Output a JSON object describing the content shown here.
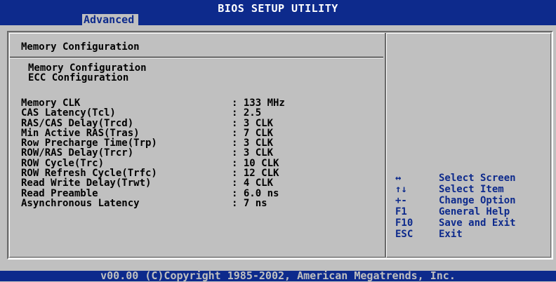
{
  "header": {
    "title": "BIOS SETUP UTILITY",
    "active_tab": "Advanced"
  },
  "panel": {
    "title": "Memory Configuration",
    "submenus": [
      "Memory Configuration",
      "ECC Configuration"
    ],
    "settings": [
      {
        "label": "Memory CLK",
        "value": ": 133 MHz"
      },
      {
        "label": "CAS Latency(Tcl)",
        "value": ": 2.5"
      },
      {
        "label": "RAS/CAS Delay(Trcd)",
        "value": ": 3 CLK"
      },
      {
        "label": "Min Active RAS(Tras)",
        "value": ": 7 CLK"
      },
      {
        "label": "Row Precharge Time(Trp)",
        "value": ": 3 CLK"
      },
      {
        "label": "ROW/RAS Delay(Trcr)",
        "value": ": 3 CLK"
      },
      {
        "label": "ROW Cycle(Trc)",
        "value": ": 10 CLK"
      },
      {
        "label": "ROW Refresh Cycle(Trfc)",
        "value": ": 12 CLK"
      },
      {
        "label": "Read Write Delay(Trwt)",
        "value": ": 4 CLK"
      },
      {
        "label": "Read Preamble",
        "value": ": 6.0 ns"
      },
      {
        "label": "Asynchronous Latency",
        "value": ": 7 ns"
      }
    ]
  },
  "help": [
    {
      "key": "↔",
      "action": "Select Screen"
    },
    {
      "key": "↑↓",
      "action": "Select Item"
    },
    {
      "key": "+-",
      "action": "Change Option"
    },
    {
      "key": "F1",
      "action": "General Help"
    },
    {
      "key": "F10",
      "action": "Save and Exit"
    },
    {
      "key": "ESC",
      "action": "Exit"
    }
  ],
  "footer": {
    "text": "v00.00 (C)Copyright 1985-2002, American Megatrends, Inc."
  },
  "colors": {
    "bios_blue": "#0d2a8c",
    "panel_gray": "#c0c0c0"
  }
}
